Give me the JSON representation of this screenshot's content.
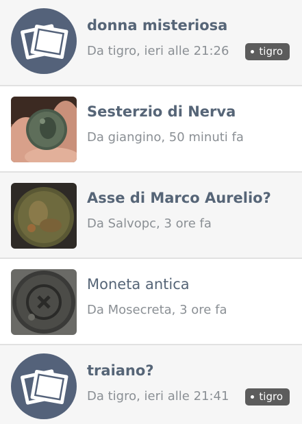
{
  "topics": [
    {
      "title": "donna misteriosa",
      "meta": "Da tigro, ieri alle 21:26",
      "tag": "tigro",
      "unread": true,
      "thumb": "placeholder-photos-icon"
    },
    {
      "title": "Sesterzio di Nerva",
      "meta": "Da giangino, 50 minuti fa",
      "tag": "",
      "unread": true,
      "thumb": "coin-in-hand-photo"
    },
    {
      "title": "Asse di Marco Aurelio?",
      "meta": "Da Salvopc, 3 ore fa",
      "tag": "",
      "unread": true,
      "thumb": "bronze-coin-photo"
    },
    {
      "title": "Moneta antica",
      "meta": "Da Mosecreta, 3 ore fa",
      "tag": "",
      "unread": false,
      "thumb": "dark-coin-photo"
    },
    {
      "title": "traiano?",
      "meta": "Da tigro, ieri alle 21:41",
      "tag": "tigro",
      "unread": true,
      "thumb": "placeholder-photos-icon"
    }
  ],
  "colors": {
    "title": "#566577",
    "meta": "#8a8f94",
    "tag_bg": "#5c5c5c",
    "avatar_bg": "#54627a"
  }
}
